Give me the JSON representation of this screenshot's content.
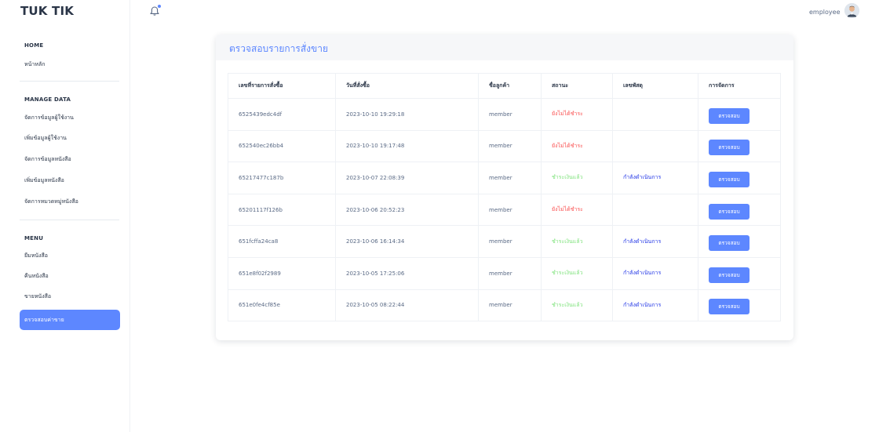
{
  "brand": "TUK TIK",
  "header": {
    "user_label": "employee"
  },
  "sidebar": {
    "sections": [
      {
        "caption": "HOME",
        "items": [
          "หน้าหลัก"
        ]
      },
      {
        "caption": "MANAGE DATA",
        "items": [
          "จัดการข้อมูลผู้ใช้งาน",
          "เพิ่มข้อมูลผู้ใช้งาน",
          "จัดการข้อมูลหนังสือ",
          "เพิ่มข้อมูลหนังสือ",
          "จัดการหมวดหมู่หนังสือ"
        ]
      },
      {
        "caption": "MENU",
        "items": [
          "ยืมหนังสือ",
          "คืนหนังสือ",
          "ขายหนังสือ",
          "ตรวจสอบค่าขาย"
        ]
      }
    ],
    "active_item": "ตรวจสอบค่าขาย"
  },
  "card": {
    "title": "ตรวจสอบรายการสั่งขาย",
    "columns": [
      "เลขที่รายการสั่งซื้อ",
      "วันที่สั่งซื้อ",
      "ชื่อลูกค้า",
      "สถานะ",
      "เลขพัสดุ",
      "การจัดการ"
    ],
    "action_label": "ตรวจสอบ",
    "rows": [
      {
        "id": "6525439edc4df",
        "date": "2023-10-10 19:29:18",
        "customer": "member",
        "status": "ยังไม่ได้ชำระ",
        "status_kind": "unpaid",
        "shipping": ""
      },
      {
        "id": "652540ec26bb4",
        "date": "2023-10-10 19:17:48",
        "customer": "member",
        "status": "ยังไม่ได้ชำระ",
        "status_kind": "unpaid",
        "shipping": ""
      },
      {
        "id": "65217477c187b",
        "date": "2023-10-07 22:08:39",
        "customer": "member",
        "status": "ชำระเงินแล้ว",
        "status_kind": "paid",
        "shipping": "กำลังดำเนินการ"
      },
      {
        "id": "65201117f126b",
        "date": "2023-10-06 20:52:23",
        "customer": "member",
        "status": "ยังไม่ได้ชำระ",
        "status_kind": "unpaid",
        "shipping": ""
      },
      {
        "id": "651fcffa24ca8",
        "date": "2023-10-06 16:14:34",
        "customer": "member",
        "status": "ชำระเงินแล้ว",
        "status_kind": "paid",
        "shipping": "กำลังดำเนินการ"
      },
      {
        "id": "651e8f02f2989",
        "date": "2023-10-05 17:25:06",
        "customer": "member",
        "status": "ชำระเงินแล้ว",
        "status_kind": "paid",
        "shipping": "กำลังดำเนินการ"
      },
      {
        "id": "651e0fe4cf85e",
        "date": "2023-10-05 08:22:44",
        "customer": "member",
        "status": "ชำระเงินแล้ว",
        "status_kind": "paid",
        "shipping": "กำลังดำเนินการ"
      }
    ]
  },
  "colors": {
    "accent": "#5d87ff",
    "unpaid": "#fa5050",
    "paid": "#7ee27b",
    "shipping": "#2135e6"
  },
  "icons": {
    "notification": "bell-icon",
    "avatar": "avatar-icon"
  }
}
